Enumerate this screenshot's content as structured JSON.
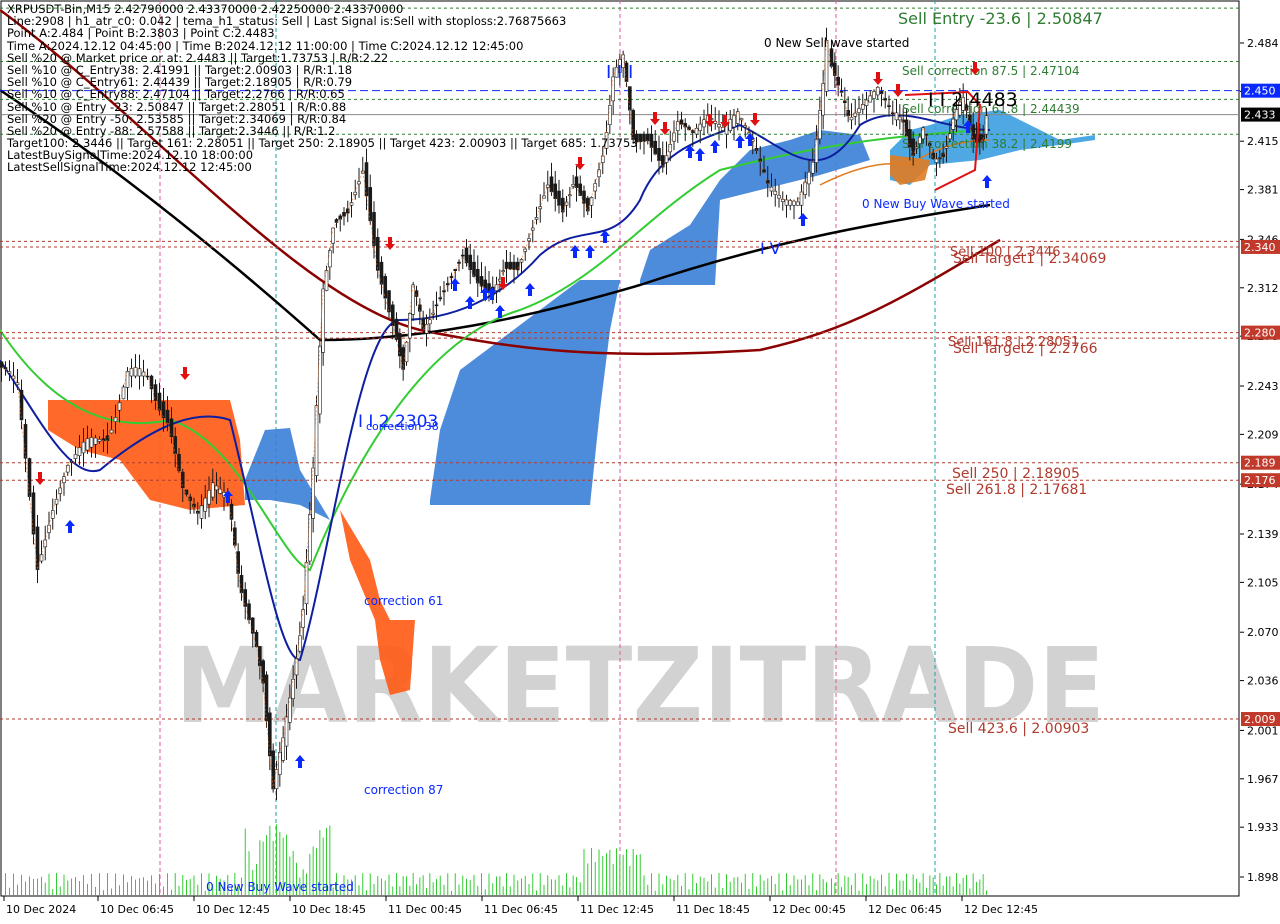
{
  "chart_data": {
    "type": "candlestick",
    "symbol_line": "XRPUSDT-Bin,M15  2.42790000 2.43370000 2.42250000 2.43370000",
    "info_lines": [
      "Line:2908 | h1_atr_c0: 0.042 | tema_h1_status: Sell | Last Signal is:Sell with stoploss:2.76875663",
      "Point A:2.484 | Point B:2.3803 | Point C:2.4483",
      "Time A:2024.12.12 04:45:00 | Time B:2024.12.12 11:00:00 | Time C:2024.12.12 12:45:00",
      "Sell %20 @ Market price or at: 2.4483 || Target:1.73753 | R/R:2.22",
      "Sell %10 @ C_Entry38: 2.41991 || Target:2.00903 | R/R:1.18",
      "Sell %10 @ C_Entry61: 2.44439 || Target:2.18905 | R/R:0.79",
      "Sell %10 @ C_Entry88: 2.47104 || Target:2.2766 | R/R:0.65",
      "Sell %10 @ Entry -23: 2.50847 || Target:2.28051 | R/R:0.88",
      "Sell %20 @ Entry -50: 2.53585 || Target:2.34069 | R/R:0.84",
      "Sell %20 @ Entry -88: 2.57588 || Target:2.3446 || R/R:1.2",
      "Target100: 2.3446 || Target 161: 2.28051 || Target 250: 2.18905 || Target 423: 2.00903 || Target 685: 1.73753",
      "LatestBuySignalTime:2024.12.10 18:00:00",
      "LatestSellSignalTime:2024.12.12 12:45:00"
    ],
    "y_ticks": [
      "2.484",
      "2.450",
      "2.415",
      "2.381",
      "2.346",
      "2.312",
      "2.278",
      "2.243",
      "2.209",
      "2.174",
      "2.139",
      "2.105",
      "2.070",
      "2.036",
      "2.001",
      "1.967",
      "1.933",
      "1.898"
    ],
    "x_ticks": [
      "10 Dec 2024",
      "10 Dec 06:45",
      "10 Dec 12:45",
      "10 Dec 18:45",
      "11 Dec 00:45",
      "11 Dec 06:45",
      "11 Dec 12:45",
      "11 Dec 18:45",
      "12 Dec 00:45",
      "12 Dec 06:45",
      "12 Dec 12:45"
    ],
    "price_badges": [
      {
        "value": "2.450",
        "price": 2.4505,
        "bg": "#0a29ff",
        "fg": "#ffffff"
      },
      {
        "value": "2.433",
        "price": 2.4337,
        "bg": "#000000",
        "fg": "#ffffff"
      },
      {
        "value": "2.340",
        "price": 2.3407,
        "bg": "#c0392b",
        "fg": "#ffffff"
      },
      {
        "value": "2.280",
        "price": 2.2805,
        "bg": "#c0392b",
        "fg": "#ffffff"
      },
      {
        "value": "2.189",
        "price": 2.1891,
        "bg": "#c0392b",
        "fg": "#ffffff"
      },
      {
        "value": "2.176",
        "price": 2.1768,
        "bg": "#c0392b",
        "fg": "#ffffff"
      },
      {
        "value": "2.009",
        "price": 2.009,
        "bg": "#c0392b",
        "fg": "#ffffff"
      }
    ],
    "levels": [
      {
        "label": "Sell Entry -23.6 | 2.50847",
        "price": 2.50847,
        "color": "#2e7d32"
      },
      {
        "label": "Sell correction 87.5 | 2.47104",
        "price": 2.47104,
        "color": "#2e7d32"
      },
      {
        "label": "Sell correction 61.8 | 2.44439",
        "price": 2.44439,
        "color": "#2e7d32"
      },
      {
        "label": "Sell correction 38.2 | 2.4199",
        "price": 2.4199,
        "color": "#2e7d32"
      },
      {
        "label": "Sell 100 | 2.3446",
        "price": 2.3446,
        "color": "#b03a2e"
      },
      {
        "label": "Sell Target1 | 2.34069",
        "price": 2.34069,
        "color": "#b03a2e"
      },
      {
        "label": "Sell 161.8 | 2.28051",
        "price": 2.28051,
        "color": "#b03a2e"
      },
      {
        "label": "Sell Target2 | 2.2766",
        "price": 2.2766,
        "color": "#b03a2e"
      },
      {
        "label": "Sell  250 | 2.18905",
        "price": 2.18905,
        "color": "#b03a2e"
      },
      {
        "label": "Sell  261.8 | 2.17681",
        "price": 2.17681,
        "color": "#b03a2e"
      },
      {
        "label": "Sell  423.6 | 2.00903",
        "price": 2.00903,
        "color": "#b03a2e"
      }
    ],
    "annotations": [
      {
        "text": "0 New Sell wave started",
        "color": "#000000"
      },
      {
        "text": "0 New Buy Wave started",
        "color": "#0a29ff"
      },
      {
        "text": "0 New Buy Wave started",
        "color": "#0a29ff"
      },
      {
        "text": "I I I",
        "color": "#0a29ff"
      },
      {
        "text": "I V",
        "color": "#0a29ff"
      },
      {
        "text": "I I 2.2303",
        "color": "#0a29ff"
      },
      {
        "text": "correction 38",
        "color": "#0a29ff"
      },
      {
        "text": "correction 61",
        "color": "#0a29ff"
      },
      {
        "text": "correction 87",
        "color": "#0a29ff"
      },
      {
        "text": "I I 2.4483",
        "color": "#000000"
      }
    ],
    "watermark": "MARKETZITRADE",
    "price_path": [
      [
        0,
        2.26
      ],
      [
        20,
        2.24
      ],
      [
        40,
        2.12
      ],
      [
        55,
        2.16
      ],
      [
        70,
        2.19
      ],
      [
        90,
        2.2
      ],
      [
        110,
        2.21
      ],
      [
        130,
        2.25
      ],
      [
        150,
        2.25
      ],
      [
        170,
        2.22
      ],
      [
        185,
        2.17
      ],
      [
        200,
        2.15
      ],
      [
        215,
        2.17
      ],
      [
        230,
        2.16
      ],
      [
        240,
        2.11
      ],
      [
        255,
        2.07
      ],
      [
        265,
        2.04
      ],
      [
        275,
        1.96
      ],
      [
        285,
        1.99
      ],
      [
        295,
        2.04
      ],
      [
        305,
        2.09
      ],
      [
        315,
        2.18
      ],
      [
        325,
        2.31
      ],
      [
        335,
        2.36
      ],
      [
        350,
        2.37
      ],
      [
        365,
        2.4
      ],
      [
        380,
        2.33
      ],
      [
        395,
        2.29
      ],
      [
        405,
        2.26
      ],
      [
        415,
        2.31
      ],
      [
        425,
        2.28
      ],
      [
        435,
        2.3
      ],
      [
        450,
        2.32
      ],
      [
        465,
        2.34
      ],
      [
        480,
        2.32
      ],
      [
        495,
        2.31
      ],
      [
        505,
        2.33
      ],
      [
        520,
        2.33
      ],
      [
        535,
        2.36
      ],
      [
        550,
        2.39
      ],
      [
        565,
        2.37
      ],
      [
        575,
        2.39
      ],
      [
        590,
        2.37
      ],
      [
        605,
        2.41
      ],
      [
        615,
        2.46
      ],
      [
        625,
        2.47
      ],
      [
        635,
        2.42
      ],
      [
        650,
        2.42
      ],
      [
        665,
        2.4
      ],
      [
        680,
        2.43
      ],
      [
        695,
        2.42
      ],
      [
        710,
        2.43
      ],
      [
        725,
        2.42
      ],
      [
        740,
        2.43
      ],
      [
        755,
        2.41
      ],
      [
        770,
        2.38
      ],
      [
        785,
        2.37
      ],
      [
        800,
        2.37
      ],
      [
        815,
        2.4
      ],
      [
        825,
        2.45
      ],
      [
        830,
        2.48
      ],
      [
        840,
        2.45
      ],
      [
        850,
        2.43
      ],
      [
        865,
        2.44
      ],
      [
        880,
        2.45
      ],
      [
        895,
        2.43
      ],
      [
        905,
        2.43
      ],
      [
        915,
        2.41
      ],
      [
        925,
        2.42
      ],
      [
        935,
        2.4
      ],
      [
        945,
        2.41
      ],
      [
        955,
        2.43
      ],
      [
        965,
        2.44
      ],
      [
        975,
        2.42
      ],
      [
        985,
        2.42
      ],
      [
        990,
        2.433
      ]
    ]
  }
}
